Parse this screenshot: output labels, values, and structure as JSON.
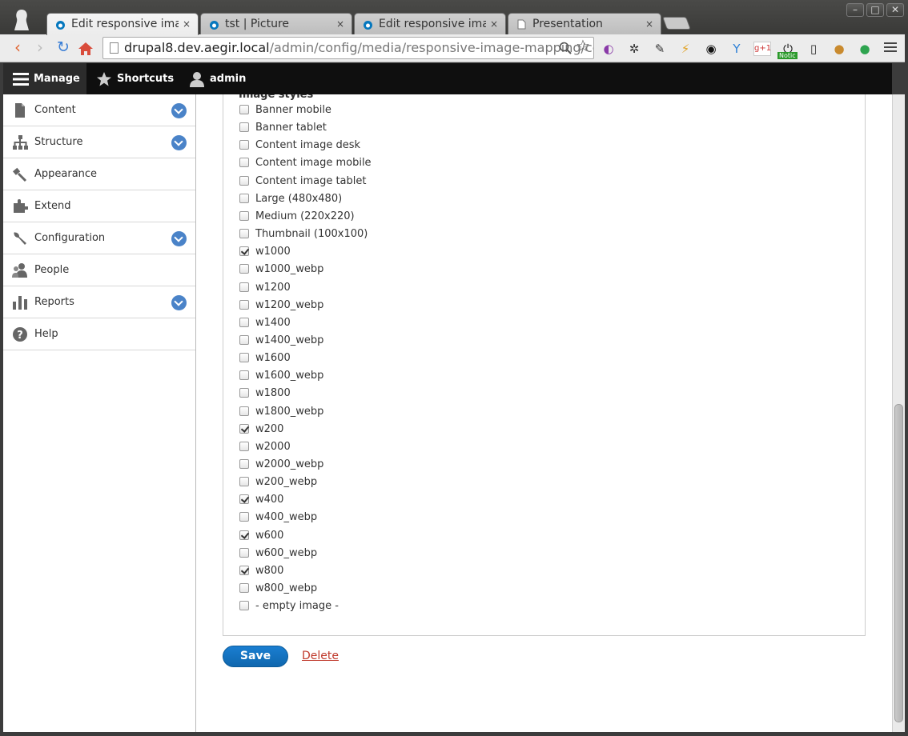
{
  "browser": {
    "tabs": [
      {
        "title": "Edit responsive image",
        "close": "×"
      },
      {
        "title": "tst | Picture",
        "close": "×"
      },
      {
        "title": "Edit responsive image",
        "close": "×"
      },
      {
        "title": "Presentation",
        "close": "×"
      }
    ],
    "url_host": "drupal8.dev.aegir.local",
    "url_path": "/admin/config/media/responsive-image-mapping/con",
    "extensions": {
      "gplus": "g+1",
      "notice_badge": "Notic"
    },
    "window_controls": {
      "minimize": "–",
      "maximize": "□",
      "close": "✕"
    }
  },
  "admin_toolbar": {
    "manage": "Manage",
    "shortcuts": "Shortcuts",
    "user": "admin"
  },
  "sidebar": {
    "items": [
      {
        "label": "Content",
        "has_toggle": true
      },
      {
        "label": "Structure",
        "has_toggle": true
      },
      {
        "label": "Appearance",
        "has_toggle": false
      },
      {
        "label": "Extend",
        "has_toggle": false
      },
      {
        "label": "Configuration",
        "has_toggle": true
      },
      {
        "label": "People",
        "has_toggle": false
      },
      {
        "label": "Reports",
        "has_toggle": true
      },
      {
        "label": "Help",
        "has_toggle": false
      }
    ]
  },
  "form": {
    "legend": "Image styles",
    "options": [
      {
        "label": "Banner mobile",
        "checked": false
      },
      {
        "label": "Banner tablet",
        "checked": false
      },
      {
        "label": "Content image desk",
        "checked": false
      },
      {
        "label": "Content image mobile",
        "checked": false
      },
      {
        "label": "Content image tablet",
        "checked": false
      },
      {
        "label": "Large (480x480)",
        "checked": false
      },
      {
        "label": "Medium (220x220)",
        "checked": false
      },
      {
        "label": "Thumbnail (100x100)",
        "checked": false
      },
      {
        "label": "w1000",
        "checked": true
      },
      {
        "label": "w1000_webp",
        "checked": false
      },
      {
        "label": "w1200",
        "checked": false
      },
      {
        "label": "w1200_webp",
        "checked": false
      },
      {
        "label": "w1400",
        "checked": false
      },
      {
        "label": "w1400_webp",
        "checked": false
      },
      {
        "label": "w1600",
        "checked": false
      },
      {
        "label": "w1600_webp",
        "checked": false
      },
      {
        "label": "w1800",
        "checked": false
      },
      {
        "label": "w1800_webp",
        "checked": false
      },
      {
        "label": "w200",
        "checked": true
      },
      {
        "label": "w2000",
        "checked": false
      },
      {
        "label": "w2000_webp",
        "checked": false
      },
      {
        "label": "w200_webp",
        "checked": false
      },
      {
        "label": "w400",
        "checked": true
      },
      {
        "label": "w400_webp",
        "checked": false
      },
      {
        "label": "w600",
        "checked": true
      },
      {
        "label": "w600_webp",
        "checked": false
      },
      {
        "label": "w800",
        "checked": true
      },
      {
        "label": "w800_webp",
        "checked": false
      },
      {
        "label": "- empty image -",
        "checked": false
      }
    ],
    "save_label": "Save",
    "delete_label": "Delete"
  },
  "colors": {
    "accent": "#0f67ae",
    "delete": "#c0392b",
    "toggle": "#4a83c8"
  }
}
